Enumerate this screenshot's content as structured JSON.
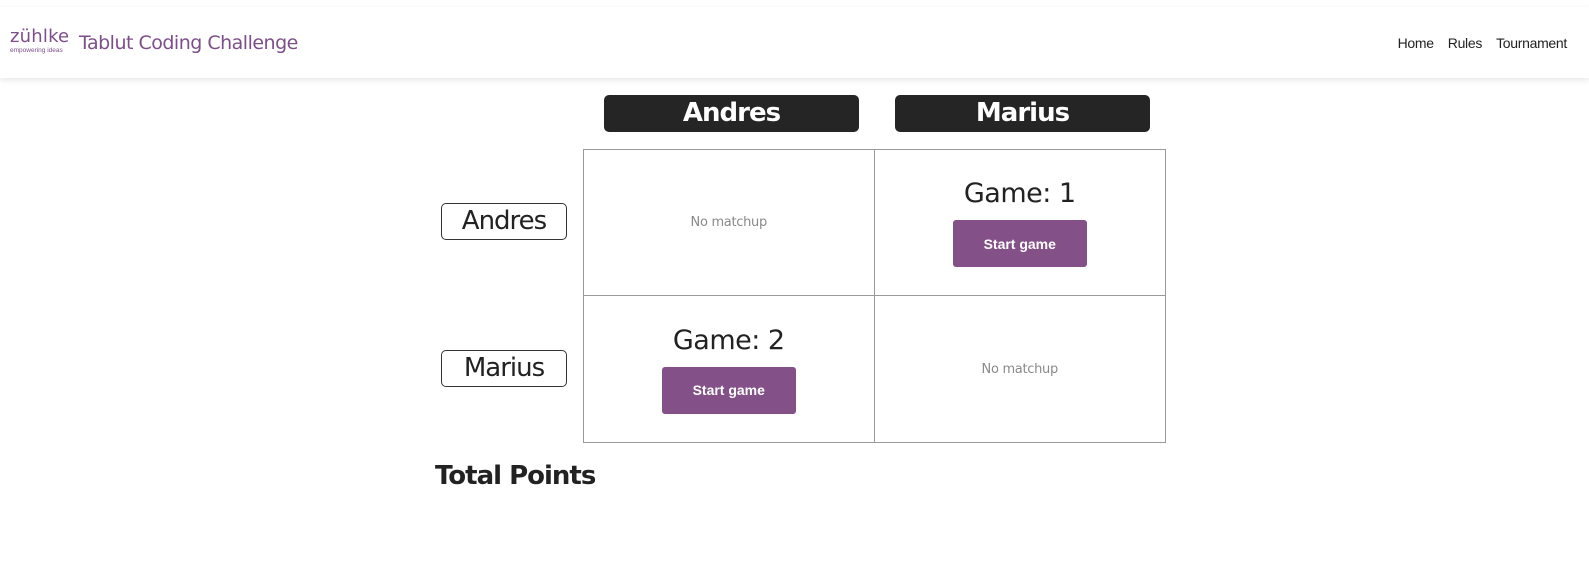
{
  "brand": {
    "logo_word": "zühlke",
    "logo_tagline": "empowering ideas",
    "title": "Tablut Coding Challenge"
  },
  "nav": {
    "links": [
      "Home",
      "Rules",
      "Tournament"
    ]
  },
  "matrix": {
    "columns": [
      "Andres",
      "Marius"
    ],
    "rows": [
      "Andres",
      "Marius"
    ],
    "cells": [
      [
        {
          "type": "none",
          "text": "No matchup"
        },
        {
          "type": "game",
          "game_label": "Game: 1",
          "button_label": "Start game"
        }
      ],
      [
        {
          "type": "game",
          "game_label": "Game: 2",
          "button_label": "Start game"
        },
        {
          "type": "none",
          "text": "No matchup"
        }
      ]
    ]
  },
  "totals": {
    "heading": "Total Points"
  },
  "colors": {
    "brand_purple": "#7d4f8a",
    "button_purple": "#835087",
    "header_dark": "#252525"
  }
}
